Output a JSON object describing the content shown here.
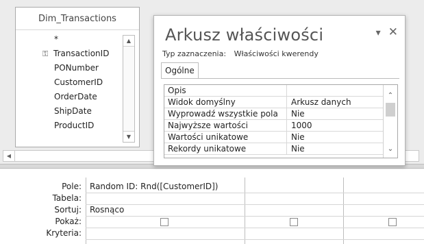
{
  "table": {
    "name": "Dim_Transactions",
    "fields": [
      "*",
      "TransactionID",
      "PONumber",
      "CustomerID",
      "OrderDate",
      "ShipDate",
      "ProductID"
    ],
    "key_field_index": 1
  },
  "property_sheet": {
    "title": "Arkusz właściwości",
    "selection_type_label": "Typ zaznaczenia:",
    "selection_type_value": "Właściwości kwerendy",
    "tab_label": "Ogólne",
    "properties": [
      {
        "name": "Opis",
        "value": ""
      },
      {
        "name": "Widok domyślny",
        "value": "Arkusz danych"
      },
      {
        "name": "Wyprowadź wszystkie pola",
        "value": "Nie"
      },
      {
        "name": "Najwyższe wartości",
        "value": "1000"
      },
      {
        "name": "Wartości unikatowe",
        "value": "Nie"
      },
      {
        "name": "Rekordy unikatowe",
        "value": "Nie"
      }
    ]
  },
  "qbe": {
    "row_labels": {
      "field": "Pole:",
      "table": "Tabela:",
      "sort": "Sortuj:",
      "show": "Pokaż:",
      "criteria": "Kryteria:"
    },
    "columns": [
      {
        "field": "Random ID: Rnd([CustomerID])",
        "table": "",
        "sort": "Rosnąco",
        "show": false
      },
      {
        "field": "",
        "table": "",
        "sort": "",
        "show": false
      },
      {
        "field": "",
        "table": "",
        "sort": "",
        "show": false
      }
    ]
  },
  "icons": {
    "key": "key-icon",
    "close": "close-icon",
    "dropdown": "chevron-down-icon"
  }
}
